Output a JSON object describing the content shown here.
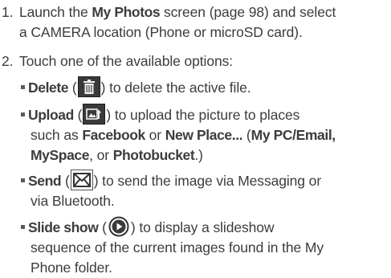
{
  "steps": [
    {
      "number": "1.",
      "line1_before": "Launch the ",
      "line1_bold": "My Photos",
      "line1_after": " screen (page 98) and select",
      "line2": "a CAMERA location (Phone or microSD card)."
    },
    {
      "number": "2.",
      "text": "Touch one of the available options:"
    }
  ],
  "options": {
    "delete": {
      "label": "Delete",
      "open": " (",
      "icon": "trash-icon",
      "close": ") to delete the active file."
    },
    "upload": {
      "label": "Upload",
      "open": " (",
      "icon": "upload-icon",
      "line1_after": ") to upload the picture to places",
      "line2_before": "such as ",
      "facebook": "Facebook",
      "or1": " or ",
      "new_place": "New Place...",
      "paren_open": " (",
      "my_pc_email": "My PC/Email",
      "line2_end": ",",
      "myspace": "MySpace",
      "or2": ", or ",
      "photobucket": "Photobucket",
      "line3_end": ".)"
    },
    "send": {
      "label": "Send",
      "open": " (",
      "icon": "envelope-icon",
      "line1_after": ") to send the image via Messaging or",
      "line2": "via Bluetooth."
    },
    "slideshow": {
      "label": "Slide show",
      "open": " (",
      "icon": "play-icon",
      "line1_after": ") to display a slideshow",
      "line2": "sequence of the current images found in the My",
      "line3": "Phone folder."
    }
  },
  "colors": {
    "text": "#3c3c3c",
    "icon_dark": "#3a3a3a"
  }
}
